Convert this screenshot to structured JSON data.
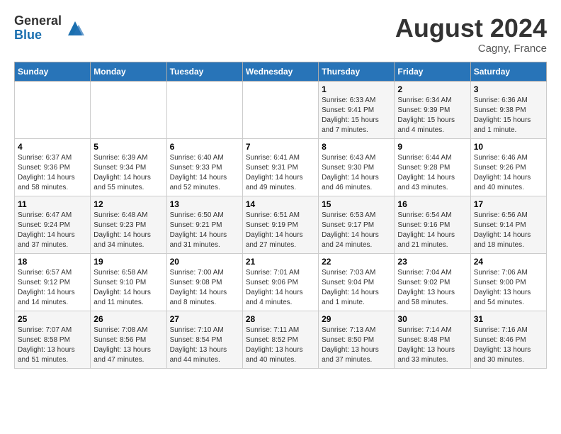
{
  "logo": {
    "general": "General",
    "blue": "Blue"
  },
  "title": {
    "month_year": "August 2024",
    "location": "Cagny, France"
  },
  "days_of_week": [
    "Sunday",
    "Monday",
    "Tuesday",
    "Wednesday",
    "Thursday",
    "Friday",
    "Saturday"
  ],
  "weeks": [
    [
      {
        "day": "",
        "info": ""
      },
      {
        "day": "",
        "info": ""
      },
      {
        "day": "",
        "info": ""
      },
      {
        "day": "",
        "info": ""
      },
      {
        "day": "1",
        "info": "Sunrise: 6:33 AM\nSunset: 9:41 PM\nDaylight: 15 hours and 7 minutes."
      },
      {
        "day": "2",
        "info": "Sunrise: 6:34 AM\nSunset: 9:39 PM\nDaylight: 15 hours and 4 minutes."
      },
      {
        "day": "3",
        "info": "Sunrise: 6:36 AM\nSunset: 9:38 PM\nDaylight: 15 hours and 1 minute."
      }
    ],
    [
      {
        "day": "4",
        "info": "Sunrise: 6:37 AM\nSunset: 9:36 PM\nDaylight: 14 hours and 58 minutes."
      },
      {
        "day": "5",
        "info": "Sunrise: 6:39 AM\nSunset: 9:34 PM\nDaylight: 14 hours and 55 minutes."
      },
      {
        "day": "6",
        "info": "Sunrise: 6:40 AM\nSunset: 9:33 PM\nDaylight: 14 hours and 52 minutes."
      },
      {
        "day": "7",
        "info": "Sunrise: 6:41 AM\nSunset: 9:31 PM\nDaylight: 14 hours and 49 minutes."
      },
      {
        "day": "8",
        "info": "Sunrise: 6:43 AM\nSunset: 9:30 PM\nDaylight: 14 hours and 46 minutes."
      },
      {
        "day": "9",
        "info": "Sunrise: 6:44 AM\nSunset: 9:28 PM\nDaylight: 14 hours and 43 minutes."
      },
      {
        "day": "10",
        "info": "Sunrise: 6:46 AM\nSunset: 9:26 PM\nDaylight: 14 hours and 40 minutes."
      }
    ],
    [
      {
        "day": "11",
        "info": "Sunrise: 6:47 AM\nSunset: 9:24 PM\nDaylight: 14 hours and 37 minutes."
      },
      {
        "day": "12",
        "info": "Sunrise: 6:48 AM\nSunset: 9:23 PM\nDaylight: 14 hours and 34 minutes."
      },
      {
        "day": "13",
        "info": "Sunrise: 6:50 AM\nSunset: 9:21 PM\nDaylight: 14 hours and 31 minutes."
      },
      {
        "day": "14",
        "info": "Sunrise: 6:51 AM\nSunset: 9:19 PM\nDaylight: 14 hours and 27 minutes."
      },
      {
        "day": "15",
        "info": "Sunrise: 6:53 AM\nSunset: 9:17 PM\nDaylight: 14 hours and 24 minutes."
      },
      {
        "day": "16",
        "info": "Sunrise: 6:54 AM\nSunset: 9:16 PM\nDaylight: 14 hours and 21 minutes."
      },
      {
        "day": "17",
        "info": "Sunrise: 6:56 AM\nSunset: 9:14 PM\nDaylight: 14 hours and 18 minutes."
      }
    ],
    [
      {
        "day": "18",
        "info": "Sunrise: 6:57 AM\nSunset: 9:12 PM\nDaylight: 14 hours and 14 minutes."
      },
      {
        "day": "19",
        "info": "Sunrise: 6:58 AM\nSunset: 9:10 PM\nDaylight: 14 hours and 11 minutes."
      },
      {
        "day": "20",
        "info": "Sunrise: 7:00 AM\nSunset: 9:08 PM\nDaylight: 14 hours and 8 minutes."
      },
      {
        "day": "21",
        "info": "Sunrise: 7:01 AM\nSunset: 9:06 PM\nDaylight: 14 hours and 4 minutes."
      },
      {
        "day": "22",
        "info": "Sunrise: 7:03 AM\nSunset: 9:04 PM\nDaylight: 14 hours and 1 minute."
      },
      {
        "day": "23",
        "info": "Sunrise: 7:04 AM\nSunset: 9:02 PM\nDaylight: 13 hours and 58 minutes."
      },
      {
        "day": "24",
        "info": "Sunrise: 7:06 AM\nSunset: 9:00 PM\nDaylight: 13 hours and 54 minutes."
      }
    ],
    [
      {
        "day": "25",
        "info": "Sunrise: 7:07 AM\nSunset: 8:58 PM\nDaylight: 13 hours and 51 minutes."
      },
      {
        "day": "26",
        "info": "Sunrise: 7:08 AM\nSunset: 8:56 PM\nDaylight: 13 hours and 47 minutes."
      },
      {
        "day": "27",
        "info": "Sunrise: 7:10 AM\nSunset: 8:54 PM\nDaylight: 13 hours and 44 minutes."
      },
      {
        "day": "28",
        "info": "Sunrise: 7:11 AM\nSunset: 8:52 PM\nDaylight: 13 hours and 40 minutes."
      },
      {
        "day": "29",
        "info": "Sunrise: 7:13 AM\nSunset: 8:50 PM\nDaylight: 13 hours and 37 minutes."
      },
      {
        "day": "30",
        "info": "Sunrise: 7:14 AM\nSunset: 8:48 PM\nDaylight: 13 hours and 33 minutes."
      },
      {
        "day": "31",
        "info": "Sunrise: 7:16 AM\nSunset: 8:46 PM\nDaylight: 13 hours and 30 minutes."
      }
    ]
  ]
}
